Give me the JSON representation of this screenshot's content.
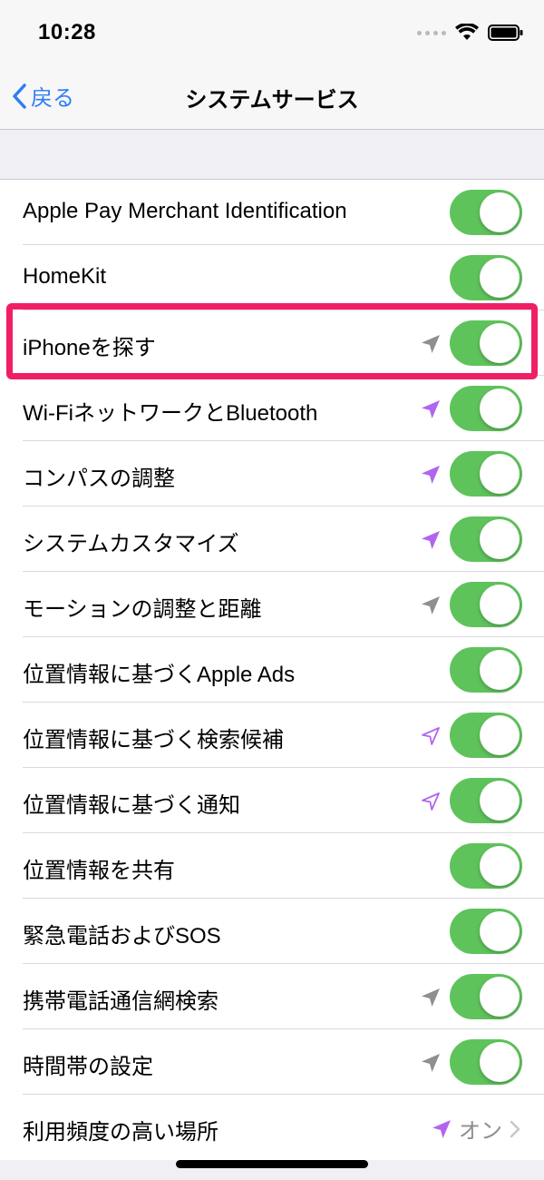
{
  "status": {
    "time": "10:28"
  },
  "nav": {
    "back_label": "戻る",
    "title": "システムサービス"
  },
  "colors": {
    "toggle_on": "#5fc35c",
    "accent": "#2f7cf6",
    "location_gray": "#8e8e93",
    "location_purple": "#b164f0",
    "highlight": "#f01f63"
  },
  "rows": [
    {
      "label": "Apple Pay Merchant Identification",
      "toggle": "on",
      "location_icon": "none"
    },
    {
      "label": "HomeKit",
      "toggle": "on",
      "location_icon": "none"
    },
    {
      "label": "iPhoneを探す",
      "toggle": "on",
      "location_icon": "location-arrow-gray",
      "highlighted": true
    },
    {
      "label": "Wi-FiネットワークとBluetooth",
      "toggle": "on",
      "location_icon": "location-arrow-purple"
    },
    {
      "label": "コンパスの調整",
      "toggle": "on",
      "location_icon": "location-arrow-purple"
    },
    {
      "label": "システムカスタマイズ",
      "toggle": "on",
      "location_icon": "location-arrow-purple"
    },
    {
      "label": "モーションの調整と距離",
      "toggle": "on",
      "location_icon": "location-arrow-gray"
    },
    {
      "label": "位置情報に基づくApple Ads",
      "toggle": "on",
      "location_icon": "none"
    },
    {
      "label": "位置情報に基づく検索候補",
      "toggle": "on",
      "location_icon": "location-arrow-outline-purple"
    },
    {
      "label": "位置情報に基づく通知",
      "toggle": "on",
      "location_icon": "location-arrow-outline-purple"
    },
    {
      "label": "位置情報を共有",
      "toggle": "on",
      "location_icon": "none"
    },
    {
      "label": "緊急電話およびSOS",
      "toggle": "on",
      "location_icon": "none"
    },
    {
      "label": "携帯電話通信網検索",
      "toggle": "on",
      "location_icon": "location-arrow-gray"
    },
    {
      "label": "時間帯の設定",
      "toggle": "on",
      "location_icon": "location-arrow-gray"
    },
    {
      "label": "利用頻度の高い場所",
      "value": "オン",
      "location_icon": "location-arrow-purple",
      "chevron": true
    }
  ]
}
